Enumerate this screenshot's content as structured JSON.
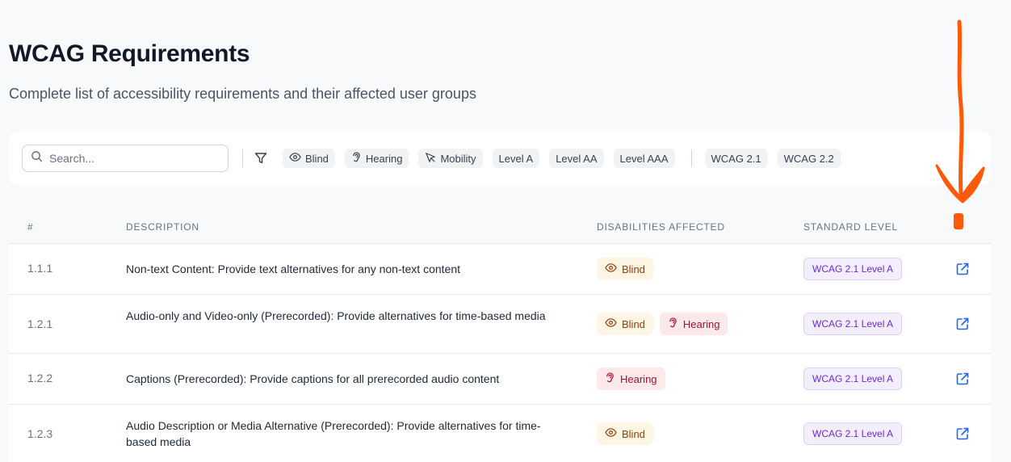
{
  "header": {
    "title": "WCAG Requirements",
    "subtitle": "Complete list of accessibility requirements and their affected user groups"
  },
  "filters": {
    "search_placeholder": "Search...",
    "disability_chips": [
      {
        "label": "Blind",
        "icon": "eye-icon"
      },
      {
        "label": "Hearing",
        "icon": "ear-icon"
      },
      {
        "label": "Mobility",
        "icon": "cursor-icon"
      }
    ],
    "level_chips": [
      "Level A",
      "Level AA",
      "Level AAA"
    ],
    "version_chips": [
      "WCAG 2.1",
      "WCAG 2.2"
    ]
  },
  "table": {
    "columns": [
      "#",
      "Description",
      "Disabilities Affected",
      "Standard Level"
    ],
    "rows": [
      {
        "id": "1.1.1",
        "description": "Non-text Content: Provide text alternatives for any non-text content",
        "disabilities": [
          "Blind"
        ],
        "level": "WCAG 2.1 Level A"
      },
      {
        "id": "1.2.1",
        "description": "Audio-only and Video-only (Prerecorded): Provide alternatives for time-based media",
        "disabilities": [
          "Blind",
          "Hearing"
        ],
        "level": "WCAG 2.1 Level A"
      },
      {
        "id": "1.2.2",
        "description": "Captions (Prerecorded): Provide captions for all prerecorded audio content",
        "disabilities": [
          "Hearing"
        ],
        "level": "WCAG 2.1 Level A"
      },
      {
        "id": "1.2.3",
        "description": "Audio Description or Media Alternative (Prerecorded): Provide alternatives for time-based media",
        "disabilities": [
          "Blind"
        ],
        "level": "WCAG 2.1 Level A"
      }
    ]
  },
  "colors": {
    "blind_badge_bg": "#fef6e4",
    "hearing_badge_bg": "#fde8ea",
    "level_badge_bg": "#f3eefe",
    "link_icon": "#2563eb",
    "annotation_arrow": "#ff5a0a"
  }
}
